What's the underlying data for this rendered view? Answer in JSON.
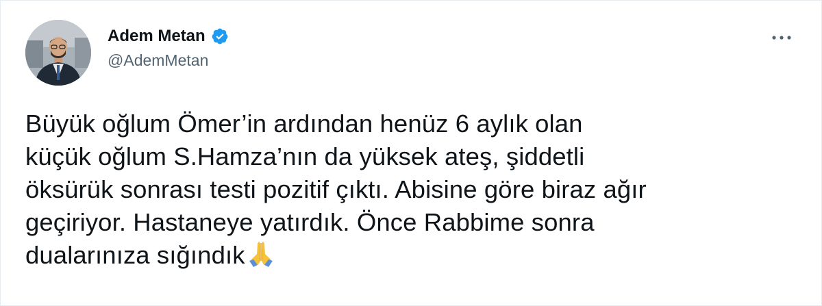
{
  "author": {
    "name": "Adem Metan",
    "handle": "@AdemMetan",
    "verified": true,
    "verified_color": "#1d9bf0"
  },
  "menu": {
    "icon": "more-horizontal-icon"
  },
  "tweet": {
    "lines": [
      "Büyük oğlum Ömer’in ardından henüz 6 aylık olan",
      "küçük oğlum S.Hamza’nın da yüksek ateş, şiddetli",
      "öksürük sonrası testi pozitif çıktı. Abisine göre biraz ağır",
      "geçiriyor. Hastaneye yatırdık. Önce Rabbime sonra",
      "dualarınıza sığındık"
    ],
    "emoji": "folded-hands-icon"
  },
  "colors": {
    "text": "#0f1419",
    "secondary": "#536471",
    "border": "#e6ecf0"
  }
}
